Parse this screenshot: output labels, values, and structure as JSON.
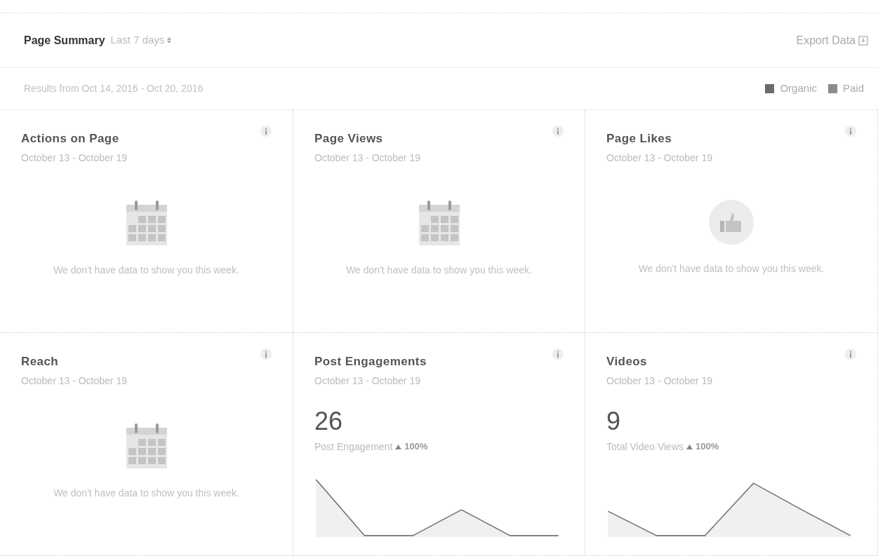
{
  "header": {
    "title": "Page Summary",
    "period": "Last 7 days",
    "export": "Export Data"
  },
  "results": "Results from Oct 14, 2016 - Oct 20, 2016",
  "legend": [
    {
      "label": "Organic",
      "color": "#6b6b6b"
    },
    {
      "label": "Paid",
      "color": "#8c8c8c"
    }
  ],
  "cards": [
    {
      "kind": "calendar",
      "title": "Actions on Page",
      "range": "October 13 - October 19",
      "message": "We don't have data to show you this week."
    },
    {
      "kind": "calendar",
      "title": "Page Views",
      "range": "October 13 - October 19",
      "message": "We don't have data to show you this week."
    },
    {
      "kind": "likes",
      "title": "Page Likes",
      "range": "October 13 - October 19",
      "message": "We don't have data to show you this week."
    },
    {
      "kind": "calendar",
      "title": "Reach",
      "range": "October 13 - October 19",
      "message": "We don't have data to show you this week."
    },
    {
      "kind": "metric",
      "title": "Post Engagements",
      "range": "October 13 - October 19",
      "value": "26",
      "caption": "Post Engagement",
      "change": "100%"
    },
    {
      "kind": "metric",
      "title": "Videos",
      "range": "October 13 - October 19",
      "value": "9",
      "caption": "Total Video Views",
      "change": "100%"
    }
  ]
}
